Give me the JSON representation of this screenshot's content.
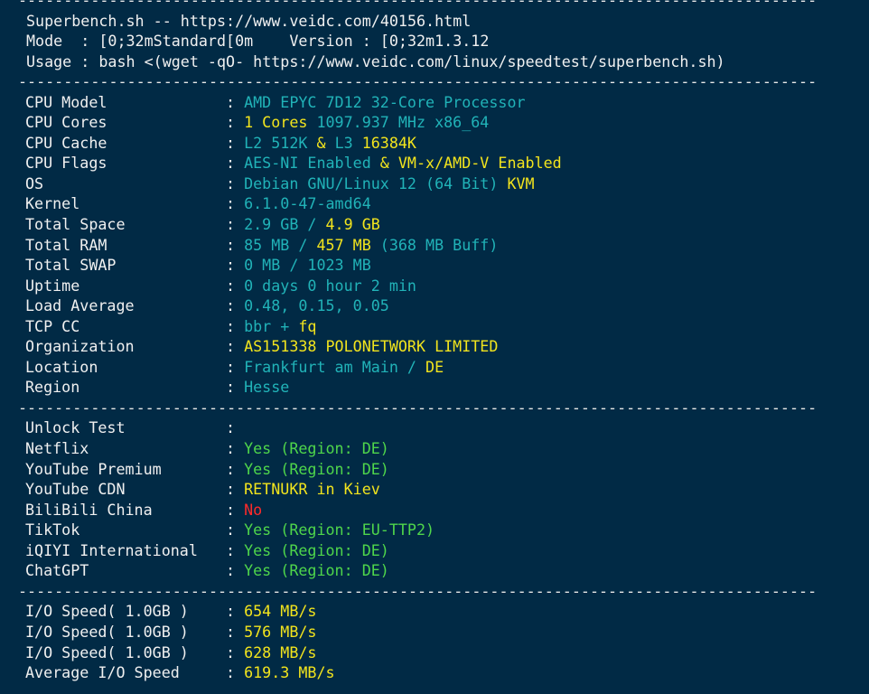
{
  "colors": {
    "background": "#012a45",
    "text": "#f0f0f0",
    "teal": "#21b3b8",
    "yellow": "#f2e41d",
    "green": "#4fd64b",
    "red": "#ff2a2a"
  },
  "separator": "----------------------------------------------------------------------------------------",
  "header": {
    "line1": "Superbench.sh -- https://www.veidc.com/40156.html",
    "line2": "Mode  : [0;32mStandard[0m    Version : [0;32m1.3.12",
    "line3": "Usage : bash <(wget -qO- https://www.veidc.com/linux/speedtest/superbench.sh)"
  },
  "system_info": [
    {
      "label": "CPU Model",
      "parts": [
        {
          "text": "AMD EPYC 7D12 32-Core Processor",
          "color": "teal"
        }
      ]
    },
    {
      "label": "CPU Cores",
      "parts": [
        {
          "text": "1 Cores",
          "color": "yellow"
        },
        {
          "text": " 1097.937 MHz x86_64",
          "color": "teal"
        }
      ]
    },
    {
      "label": "CPU Cache",
      "parts": [
        {
          "text": "L2 512K",
          "color": "teal"
        },
        {
          "text": " & ",
          "color": "yellow"
        },
        {
          "text": "L3",
          "color": "teal"
        },
        {
          "text": " 16384K",
          "color": "yellow"
        }
      ]
    },
    {
      "label": "CPU Flags",
      "parts": [
        {
          "text": "AES-NI Enabled",
          "color": "teal"
        },
        {
          "text": " & ",
          "color": "yellow"
        },
        {
          "text": "VM-x/AMD-V Enabled",
          "color": "yellow"
        }
      ]
    },
    {
      "label": "OS",
      "parts": [
        {
          "text": "Debian GNU/Linux 12 (64 Bit)",
          "color": "teal"
        },
        {
          "text": " KVM",
          "color": "yellow"
        }
      ]
    },
    {
      "label": "Kernel",
      "parts": [
        {
          "text": "6.1.0-47-amd64",
          "color": "teal"
        }
      ]
    },
    {
      "label": "Total Space",
      "parts": [
        {
          "text": "2.9 GB /",
          "color": "teal"
        },
        {
          "text": " 4.9 GB",
          "color": "yellow"
        }
      ]
    },
    {
      "label": "Total RAM",
      "parts": [
        {
          "text": "85 MB /",
          "color": "teal"
        },
        {
          "text": " 457 MB",
          "color": "yellow"
        },
        {
          "text": " (368 MB Buff)",
          "color": "teal"
        }
      ]
    },
    {
      "label": "Total SWAP",
      "parts": [
        {
          "text": "0 MB / 1023 MB",
          "color": "teal"
        }
      ]
    },
    {
      "label": "Uptime",
      "parts": [
        {
          "text": "0 days 0 hour 2 min",
          "color": "teal"
        }
      ]
    },
    {
      "label": "Load Average",
      "parts": [
        {
          "text": "0.48, 0.15, 0.05",
          "color": "teal"
        }
      ]
    },
    {
      "label": "TCP CC",
      "parts": [
        {
          "text": "bbr + ",
          "color": "teal"
        },
        {
          "text": "fq",
          "color": "yellow"
        }
      ]
    },
    {
      "label": "Organization",
      "parts": [
        {
          "text": "AS151338 POLONETWORK LIMITED",
          "color": "yellow"
        }
      ]
    },
    {
      "label": "Location",
      "parts": [
        {
          "text": "Frankfurt am Main /",
          "color": "teal"
        },
        {
          "text": " DE",
          "color": "yellow"
        }
      ]
    },
    {
      "label": "Region",
      "parts": [
        {
          "text": "Hesse",
          "color": "teal"
        }
      ]
    }
  ],
  "unlock_test": [
    {
      "label": "Unlock Test",
      "parts": []
    },
    {
      "label": "Netflix",
      "parts": [
        {
          "text": "Yes (Region: DE)",
          "color": "green"
        }
      ]
    },
    {
      "label": "YouTube Premium",
      "parts": [
        {
          "text": "Yes (Region: DE)",
          "color": "green"
        }
      ]
    },
    {
      "label": "YouTube CDN",
      "parts": [
        {
          "text": "RETNUKR in Kiev",
          "color": "yellow"
        }
      ]
    },
    {
      "label": "BiliBili China",
      "parts": [
        {
          "text": "No",
          "color": "red"
        }
      ]
    },
    {
      "label": "TikTok",
      "parts": [
        {
          "text": "Yes (Region: EU-TTP2)",
          "color": "green"
        }
      ]
    },
    {
      "label": "iQIYI International",
      "parts": [
        {
          "text": "Yes (Region: DE)",
          "color": "green"
        }
      ]
    },
    {
      "label": "ChatGPT",
      "parts": [
        {
          "text": "Yes (Region: DE)",
          "color": "green"
        }
      ]
    }
  ],
  "io_test": [
    {
      "label": "I/O Speed( 1.0GB )",
      "parts": [
        {
          "text": "654 MB/s",
          "color": "yellow"
        }
      ]
    },
    {
      "label": "I/O Speed( 1.0GB )",
      "parts": [
        {
          "text": "576 MB/s",
          "color": "yellow"
        }
      ]
    },
    {
      "label": "I/O Speed( 1.0GB )",
      "parts": [
        {
          "text": "628 MB/s",
          "color": "yellow"
        }
      ]
    },
    {
      "label": "Average I/O Speed",
      "parts": [
        {
          "text": "619.3 MB/s",
          "color": "yellow"
        }
      ]
    }
  ]
}
